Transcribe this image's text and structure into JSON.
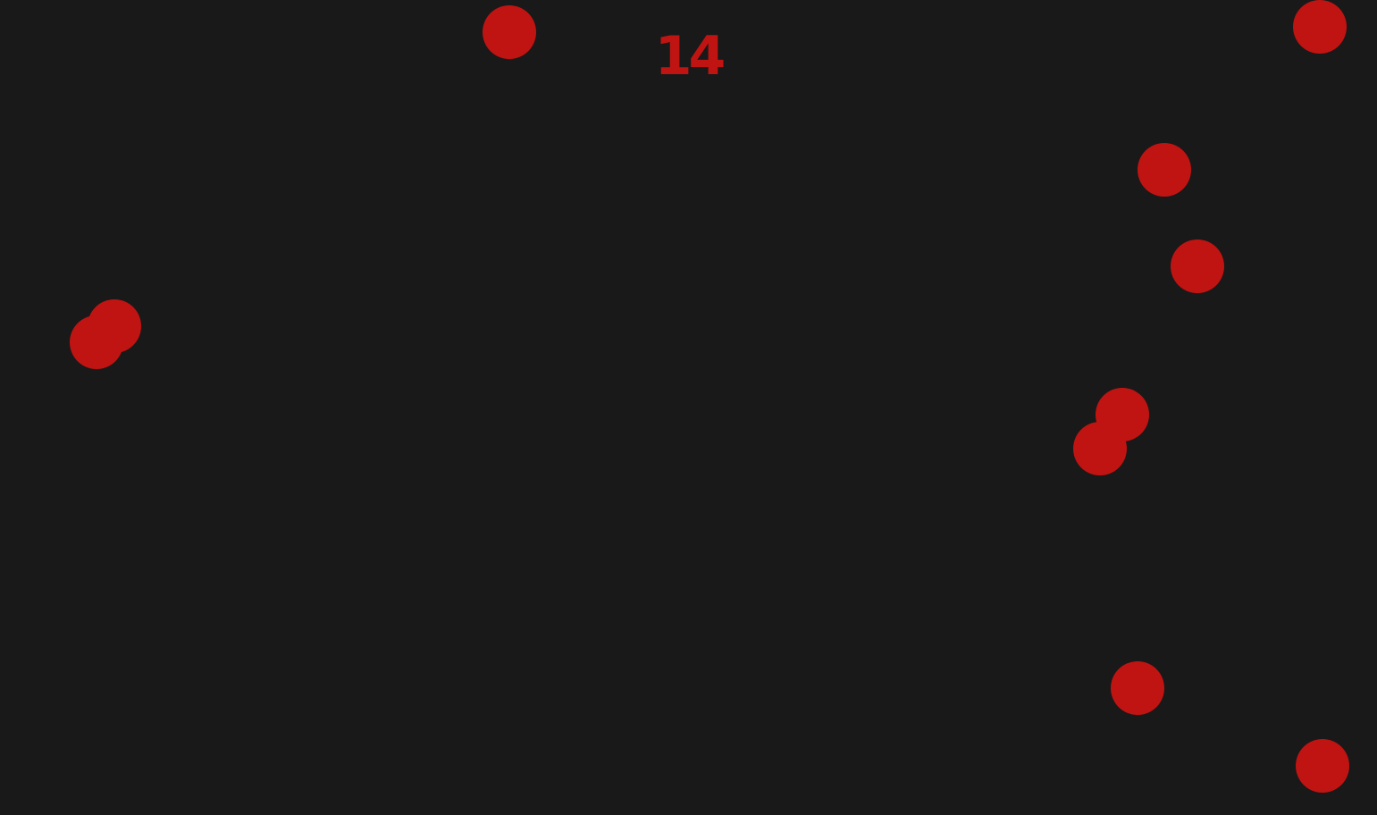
{
  "game": {
    "score": "14",
    "background_color": "#191919",
    "ball_color": "#c01412",
    "score_color": "#c01412",
    "balls": [
      {
        "id": "ball-1"
      },
      {
        "id": "ball-2"
      },
      {
        "id": "ball-3"
      },
      {
        "id": "ball-4"
      },
      {
        "id": "ball-5"
      },
      {
        "id": "ball-6"
      },
      {
        "id": "ball-7"
      },
      {
        "id": "ball-8"
      },
      {
        "id": "ball-9"
      },
      {
        "id": "ball-10"
      },
      {
        "id": "ball-11"
      }
    ]
  }
}
